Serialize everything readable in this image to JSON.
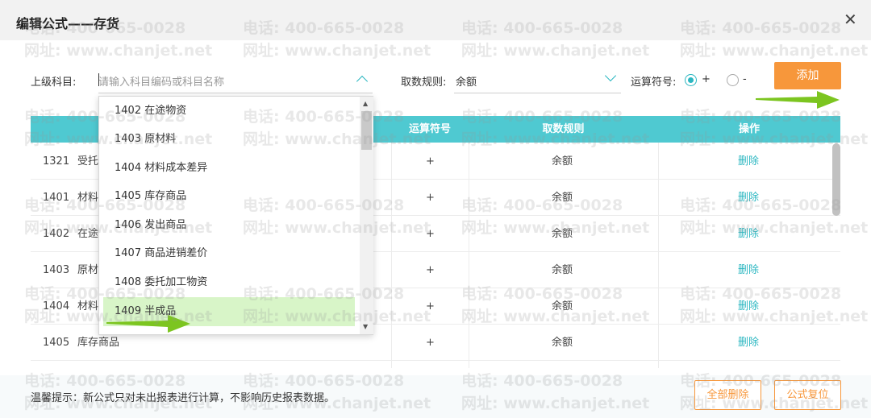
{
  "dialog": {
    "title": "编辑公式——存货",
    "close_glyph": "✕"
  },
  "form": {
    "parent_subject_label": "上级科目:",
    "parent_subject_placeholder": "请输入科目编码或科目名称",
    "fetch_rule_label": "取数规则:",
    "fetch_rule_value": "余额",
    "operator_label": "运算符号:",
    "operator_plus": "+",
    "operator_minus": "-",
    "operator_selected": "+",
    "add_button": "添加"
  },
  "table": {
    "columns": [
      "运算符号",
      "取数规则",
      "操作"
    ],
    "rows": [
      {
        "code": "1321",
        "name": "受托",
        "op": "+",
        "rule": "余额",
        "action": "删除"
      },
      {
        "code": "1401",
        "name": "材料",
        "op": "+",
        "rule": "余额",
        "action": "删除"
      },
      {
        "code": "1402",
        "name": "在途",
        "op": "+",
        "rule": "余额",
        "action": "删除"
      },
      {
        "code": "1403",
        "name": "原材",
        "op": "+",
        "rule": "余额",
        "action": "删除"
      },
      {
        "code": "1404",
        "name": "材料",
        "op": "+",
        "rule": "余额",
        "action": "删除"
      },
      {
        "code": "1405",
        "name": "库存商品",
        "op": "+",
        "rule": "余额",
        "action": "删除"
      }
    ]
  },
  "dropdown": {
    "items": [
      "1402 在途物资",
      "1403 原材料",
      "1404 材料成本差异",
      "1405 库存商品",
      "1406 发出商品",
      "1407 商品进销差价",
      "1408 委托加工物资",
      "1409 半成品"
    ],
    "highlighted": "1409 半成品",
    "scroll_up": "▲",
    "scroll_down": "▼"
  },
  "footer": {
    "tip": "温馨提示：新公式只对未出报表进行计算，不影响历史报表数据。",
    "delete_all_button": "全部删除",
    "reset_button": "公式复位"
  },
  "watermark": {
    "phone": "电话: 400-665-0028",
    "site": "网址: www.chanjet.net"
  },
  "colors": {
    "accent": "#4fc9d1",
    "link": "#2bb7c1",
    "orange": "#f7973b",
    "highlight": "#d8f5c8",
    "arrow_green": "#7cc520"
  }
}
